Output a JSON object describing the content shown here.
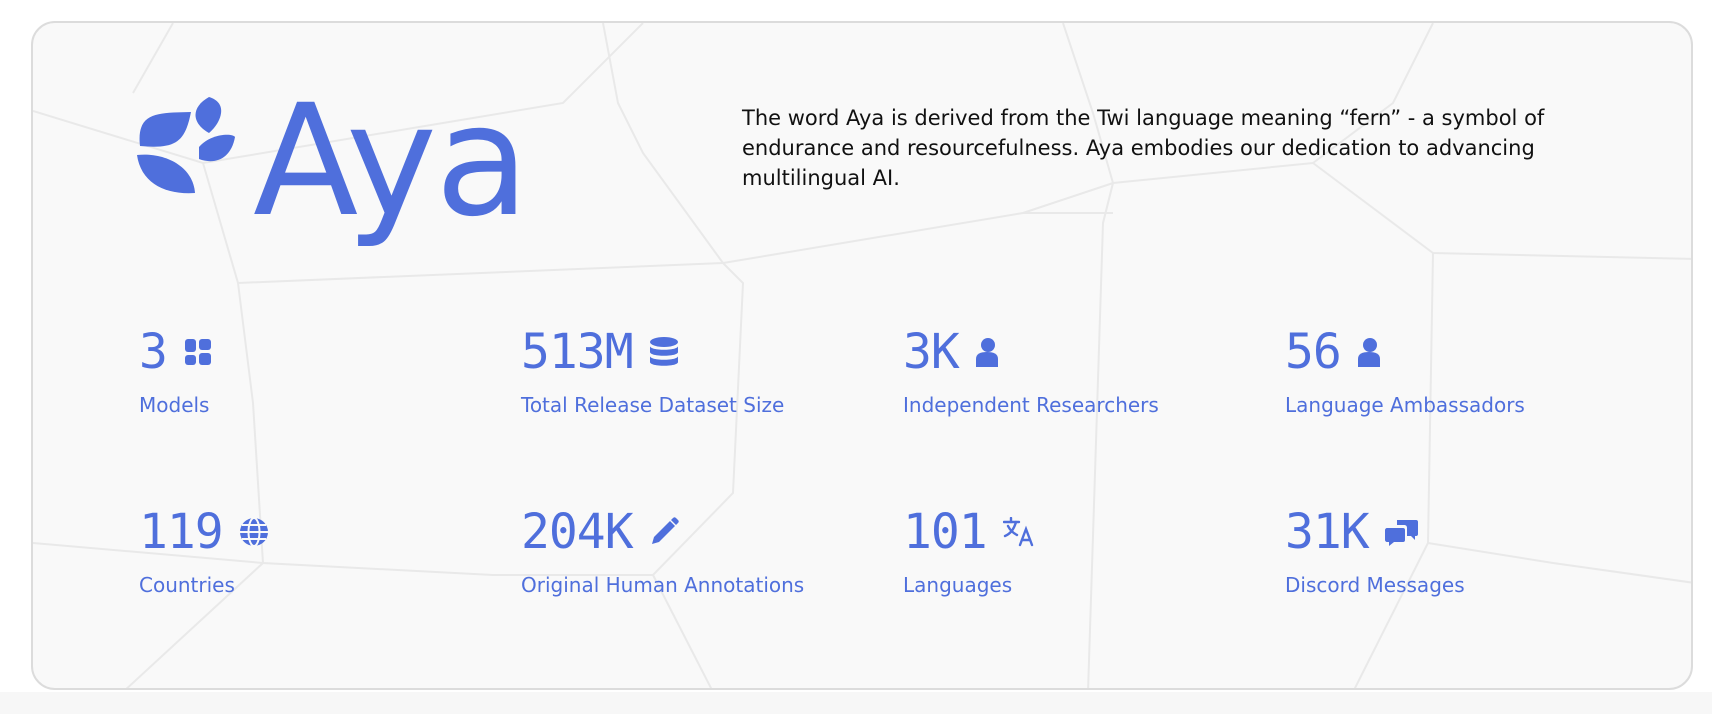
{
  "brand": {
    "name": "Aya",
    "color": "#4f6fdc"
  },
  "description": "The word Aya is derived from the Twi language meaning “fern” - a symbol of endurance and resourcefulness. Aya embodies our dedication to advancing multilingual AI.",
  "stats": [
    {
      "value": "3",
      "label": "Models",
      "icon": "models-icon"
    },
    {
      "value": "513M",
      "label": "Total Release Dataset Size",
      "icon": "database-icon"
    },
    {
      "value": "3K",
      "label": "Independent Researchers",
      "icon": "person-icon"
    },
    {
      "value": "56",
      "label": "Language Ambassadors",
      "icon": "person-icon"
    },
    {
      "value": "119",
      "label": "Countries",
      "icon": "globe-icon"
    },
    {
      "value": "204K",
      "label": "Original Human Annotations",
      "icon": "pencil-icon"
    },
    {
      "value": "101",
      "label": "Languages",
      "icon": "translate-icon"
    },
    {
      "value": "31K",
      "label": "Discord Messages",
      "icon": "chat-icon"
    }
  ]
}
